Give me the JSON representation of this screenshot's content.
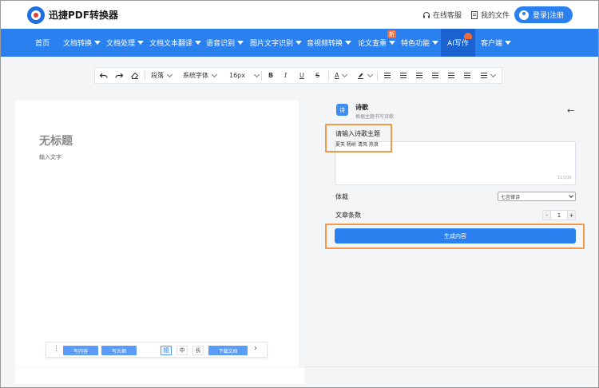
{
  "header": {
    "brand": "迅捷PDF转换器",
    "service_label": "在线客服",
    "files_label": "我的文件",
    "login_label": "登录|注册"
  },
  "nav": {
    "items": [
      {
        "label": "首页"
      },
      {
        "label": "文档转换"
      },
      {
        "label": "文档处理"
      },
      {
        "label": "文档文本翻译"
      },
      {
        "label": "语音识别"
      },
      {
        "label": "图片文字识别"
      },
      {
        "label": "音视频转换"
      },
      {
        "label": "论文查重"
      },
      {
        "label": "特色功能"
      },
      {
        "label": "AI写作"
      },
      {
        "label": "客户端"
      }
    ],
    "new_badge": "新",
    "active": "AI写作"
  },
  "toolbar": {
    "paragraph": "段落",
    "font": "系统字体",
    "size": "16px",
    "bold": "B",
    "italic": "I",
    "underline": "U",
    "strike": "S",
    "font_color": "A"
  },
  "editor": {
    "title": "无标题",
    "placeholder": "输入文字",
    "write_content": "写内容",
    "write_outline": "写大纲",
    "len_short": "短",
    "len_medium": "中",
    "len_long": "长",
    "download": "下载文档"
  },
  "panel": {
    "icon_text": "诗",
    "title": "诗歌",
    "subtitle": "根据主题书写诗歌",
    "topic_label": "请输入诗歌主题",
    "topic_value": "夏天 杨树 清风 热浪",
    "char_count": "11/100",
    "genre_label": "体裁",
    "genre_value": "七言律诗",
    "count_label": "文章条数",
    "count_minus": "-",
    "count_value": "1",
    "count_plus": "+",
    "generate": "生成内容"
  },
  "colors": {
    "primary": "#2b80f0",
    "highlight": "#f39a4a",
    "badge": "#f26b3a"
  }
}
